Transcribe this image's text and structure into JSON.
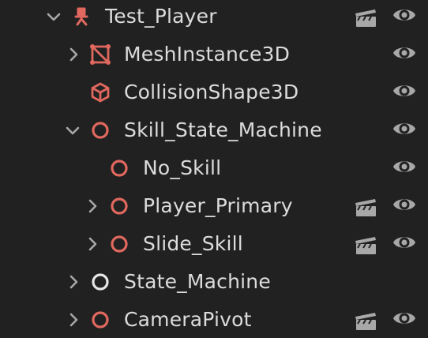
{
  "scene_tree": {
    "nodes": [
      {
        "name": "Test_Player",
        "icon": "player-node-icon",
        "expanded": true,
        "has_animation": true,
        "visible": true
      },
      {
        "name": "MeshInstance3D",
        "icon": "mesh-instance-icon",
        "expanded": false,
        "has_animation": false,
        "visible": true
      },
      {
        "name": "CollisionShape3D",
        "icon": "collision-shape-icon",
        "has_animation": false,
        "visible": true
      },
      {
        "name": "Skill_State_Machine",
        "icon": "node-circle-icon",
        "expanded": true,
        "has_animation": false,
        "visible": true
      },
      {
        "name": "No_Skill",
        "icon": "node-circle-icon",
        "has_animation": false,
        "visible": true
      },
      {
        "name": "Player_Primary",
        "icon": "node-circle-icon",
        "expanded": false,
        "has_animation": true,
        "visible": true
      },
      {
        "name": "Slide_Skill",
        "icon": "node-circle-icon",
        "expanded": false,
        "has_animation": true,
        "visible": true
      },
      {
        "name": "State_Machine",
        "icon": "node-circle-icon",
        "expanded": false,
        "has_animation": false,
        "visible": false
      },
      {
        "name": "CameraPivot",
        "icon": "node-circle-icon",
        "expanded": false,
        "has_animation": true,
        "visible": true
      }
    ]
  },
  "colors": {
    "background": "#212121",
    "text": "#dcdcdc",
    "icon_red": "#e0685e",
    "icon_white": "#e6e6e6",
    "control_gray": "#a8a8a8"
  }
}
